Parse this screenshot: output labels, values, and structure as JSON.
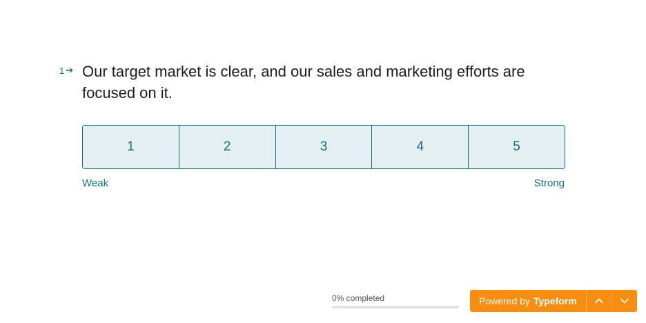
{
  "question": {
    "number": "1",
    "title": "Our target market is clear, and our sales and marketing efforts are focused on it."
  },
  "scale": {
    "options": [
      "1",
      "2",
      "3",
      "4",
      "5"
    ],
    "left_label": "Weak",
    "right_label": "Strong"
  },
  "progress": {
    "text": "0% completed",
    "percent": 0
  },
  "footer": {
    "powered_prefix": "Powered by",
    "brand": "Typeform",
    "up_icon": "chevron-up-icon",
    "down_icon": "chevron-down-icon"
  },
  "colors": {
    "accent": "#0f6e7d",
    "option_bg": "#e3eff1",
    "brand_orange": "#f98d0f"
  }
}
